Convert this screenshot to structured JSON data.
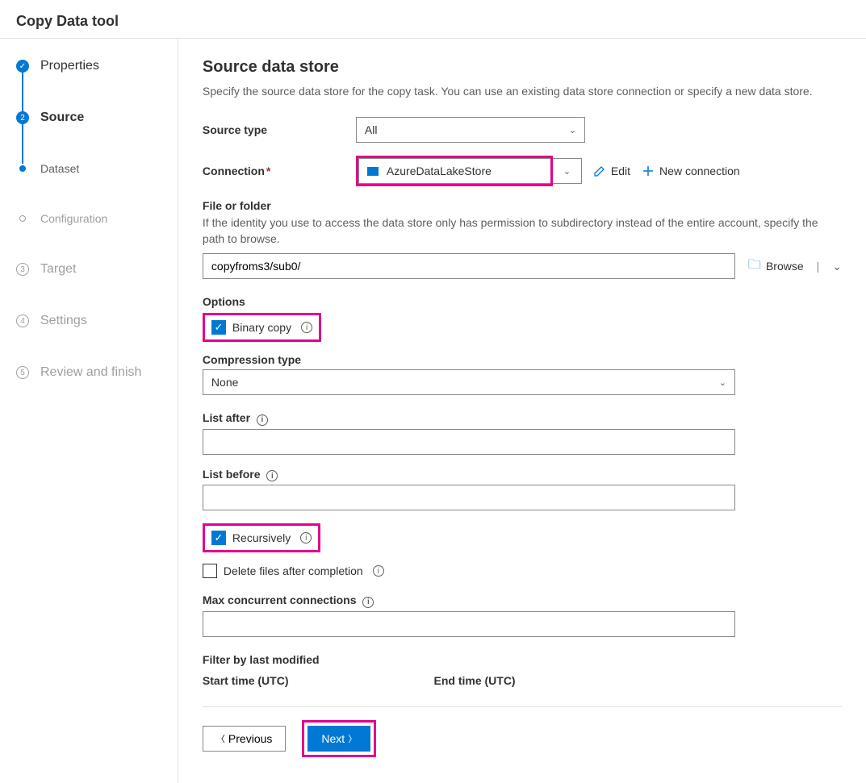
{
  "header": {
    "title": "Copy Data tool"
  },
  "sidebar": {
    "steps": [
      {
        "label": "Properties",
        "kind": "completed",
        "mark": "✓"
      },
      {
        "label": "Source",
        "kind": "current",
        "mark": "2"
      },
      {
        "label": "Dataset",
        "kind": "substep",
        "mark": ""
      },
      {
        "label": "Configuration",
        "kind": "upcoming-sub",
        "mark": ""
      },
      {
        "label": "Target",
        "kind": "upcoming",
        "mark": "3"
      },
      {
        "label": "Settings",
        "kind": "upcoming",
        "mark": "4"
      },
      {
        "label": "Review and finish",
        "kind": "upcoming",
        "mark": "5"
      }
    ]
  },
  "main": {
    "title": "Source data store",
    "subtitle": "Specify the source data store for the copy task. You can use an existing data store connection or specify a new data store.",
    "source_type_label": "Source type",
    "source_type_value": "All",
    "connection_label": "Connection",
    "connection_value": "AzureDataLakeStore",
    "edit_label": "Edit",
    "new_conn_label": "New connection",
    "file_folder_label": "File or folder",
    "file_folder_help": "If the identity you use to access the data store only has permission to subdirectory instead of the entire account, specify the path to browse.",
    "file_folder_value": "copyfroms3/sub0/",
    "browse_label": "Browse",
    "options_label": "Options",
    "binary_copy_label": "Binary copy",
    "compression_label": "Compression type",
    "compression_value": "None",
    "list_after_label": "List after",
    "list_after_value": "",
    "list_before_label": "List before",
    "list_before_value": "",
    "recursively_label": "Recursively",
    "delete_after_label": "Delete files after completion",
    "max_conn_label": "Max concurrent connections",
    "max_conn_value": "",
    "filter_label": "Filter by last modified",
    "start_time_label": "Start time (UTC)",
    "end_time_label": "End time (UTC)",
    "previous_label": "Previous",
    "next_label": "Next"
  }
}
